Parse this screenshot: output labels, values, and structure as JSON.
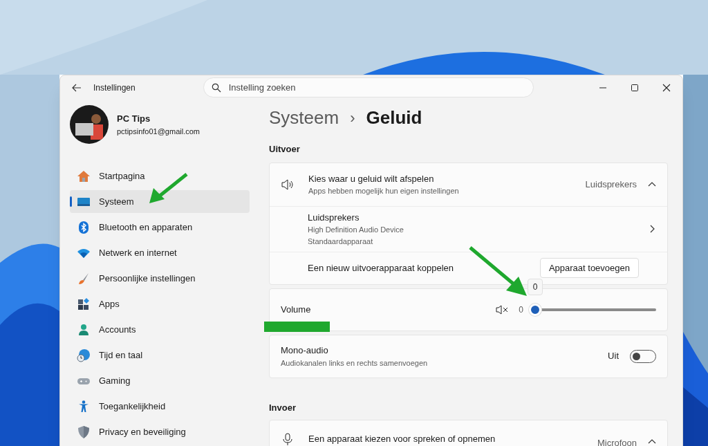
{
  "window": {
    "title": "Instellingen"
  },
  "search": {
    "placeholder": "Instelling zoeken"
  },
  "account": {
    "name": "PC Tips",
    "email": "pctipsinfo01@gmail.com"
  },
  "sidebar": {
    "items": [
      {
        "label": "Startpagina",
        "kind": "home",
        "selected": false
      },
      {
        "label": "Systeem",
        "kind": "system",
        "selected": true
      },
      {
        "label": "Bluetooth en apparaten",
        "kind": "bluetooth",
        "selected": false
      },
      {
        "label": "Netwerk en internet",
        "kind": "network",
        "selected": false
      },
      {
        "label": "Persoonlijke instellingen",
        "kind": "personalization",
        "selected": false
      },
      {
        "label": "Apps",
        "kind": "apps",
        "selected": false
      },
      {
        "label": "Accounts",
        "kind": "accounts",
        "selected": false
      },
      {
        "label": "Tijd en taal",
        "kind": "time",
        "selected": false
      },
      {
        "label": "Gaming",
        "kind": "gaming",
        "selected": false
      },
      {
        "label": "Toegankelijkheid",
        "kind": "accessibility",
        "selected": false
      },
      {
        "label": "Privacy en beveiliging",
        "kind": "privacy",
        "selected": false
      }
    ]
  },
  "breadcrumb": {
    "parent": "Systeem",
    "separator": "›",
    "current": "Geluid"
  },
  "output": {
    "heading": "Uitvoer",
    "choose": {
      "title": "Kies waar u geluid wilt afspelen",
      "subtitle": "Apps hebben mogelijk hun eigen instellingen",
      "value": "Luidsprekers",
      "expanded": true
    },
    "device": {
      "title": "Luidsprekers",
      "lines": [
        "High Definition Audio Device",
        "Standaardapparaat"
      ]
    },
    "pair": {
      "label": "Een nieuw uitvoerapparaat koppelen",
      "button": "Apparaat toevoegen"
    },
    "volume": {
      "label": "Volume",
      "muted": true,
      "reading": "0",
      "tooltip": "0",
      "level": 0
    },
    "mono": {
      "title": "Mono-audio",
      "subtitle": "Audiokanalen links en rechts samenvoegen",
      "state_label": "Uit",
      "on": false
    }
  },
  "input": {
    "heading": "Invoer",
    "choose": {
      "title": "Een apparaat kiezen voor spreken of opnemen",
      "value": "Microfoon",
      "expanded": true
    }
  }
}
